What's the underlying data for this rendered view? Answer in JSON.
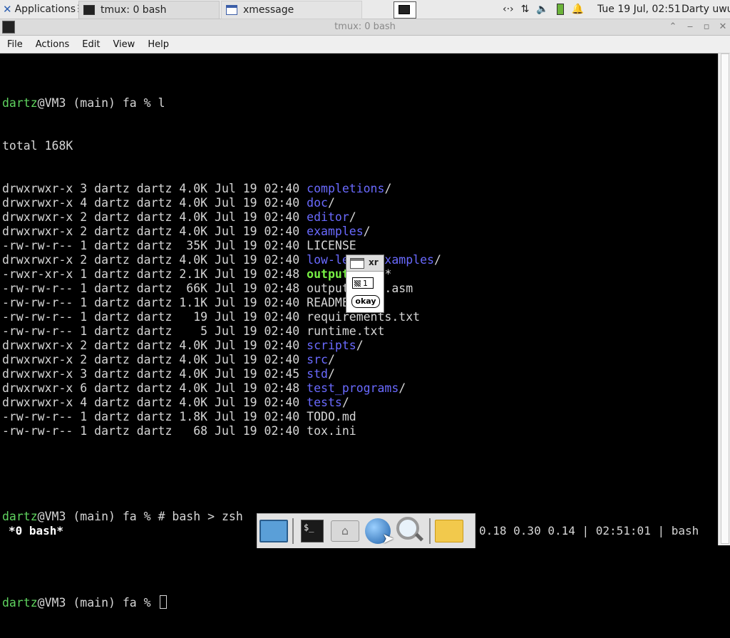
{
  "top_panel": {
    "applications_label": "Applications",
    "tasks": [
      {
        "label": "tmux: 0 bash"
      },
      {
        "label": "xmessage"
      }
    ],
    "clock": "Tue 19 Jul, 02:51",
    "user": "Darty uwu"
  },
  "window": {
    "title": "tmux: 0 bash",
    "menu": [
      "File",
      "Actions",
      "Edit",
      "View",
      "Help"
    ]
  },
  "terminal": {
    "user": "dartz",
    "prompt_rest": "@VM3 (main) fa % ",
    "command1": "l",
    "total": "total 168K",
    "listing": [
      {
        "perm": "drwxrwxr-x 3 dartz dartz 4.0K Jul 19 02:40 ",
        "name": "completions",
        "suffix": "/",
        "kind": "dir"
      },
      {
        "perm": "drwxrwxr-x 4 dartz dartz 4.0K Jul 19 02:40 ",
        "name": "doc",
        "suffix": "/",
        "kind": "dir"
      },
      {
        "perm": "drwxrwxr-x 2 dartz dartz 4.0K Jul 19 02:40 ",
        "name": "editor",
        "suffix": "/",
        "kind": "dir"
      },
      {
        "perm": "drwxrwxr-x 2 dartz dartz 4.0K Jul 19 02:40 ",
        "name": "examples",
        "suffix": "/",
        "kind": "dir"
      },
      {
        "perm": "-rw-rw-r-- 1 dartz dartz  35K Jul 19 02:40 ",
        "name": "LICENSE",
        "suffix": "",
        "kind": "file"
      },
      {
        "perm": "drwxrwxr-x 2 dartz dartz 4.0K Jul 19 02:40 ",
        "name": "low-level-examples",
        "suffix": "/",
        "kind": "dir"
      },
      {
        "perm": "-rwxr-xr-x 1 dartz dartz 2.1K Jul 19 02:48 ",
        "name": "output_file",
        "suffix": "*",
        "kind": "exec"
      },
      {
        "perm": "-rw-rw-r-- 1 dartz dartz  66K Jul 19 02:48 ",
        "name": "output_file.asm",
        "suffix": "",
        "kind": "file"
      },
      {
        "perm": "-rw-rw-r-- 1 dartz dartz 1.1K Jul 19 02:40 ",
        "name": "README.md",
        "suffix": "",
        "kind": "file"
      },
      {
        "perm": "-rw-rw-r-- 1 dartz dartz   19 Jul 19 02:40 ",
        "name": "requirements.txt",
        "suffix": "",
        "kind": "file"
      },
      {
        "perm": "-rw-rw-r-- 1 dartz dartz    5 Jul 19 02:40 ",
        "name": "runtime.txt",
        "suffix": "",
        "kind": "file"
      },
      {
        "perm": "drwxrwxr-x 2 dartz dartz 4.0K Jul 19 02:40 ",
        "name": "scripts",
        "suffix": "/",
        "kind": "dir"
      },
      {
        "perm": "drwxrwxr-x 2 dartz dartz 4.0K Jul 19 02:40 ",
        "name": "src",
        "suffix": "/",
        "kind": "dir"
      },
      {
        "perm": "drwxrwxr-x 3 dartz dartz 4.0K Jul 19 02:45 ",
        "name": "std",
        "suffix": "/",
        "kind": "dir"
      },
      {
        "perm": "drwxrwxr-x 6 dartz dartz 4.0K Jul 19 02:48 ",
        "name": "test_programs",
        "suffix": "/",
        "kind": "dir"
      },
      {
        "perm": "drwxrwxr-x 4 dartz dartz 4.0K Jul 19 02:40 ",
        "name": "tests",
        "suffix": "/",
        "kind": "dir"
      },
      {
        "perm": "-rw-rw-r-- 1 dartz dartz 1.8K Jul 19 02:40 ",
        "name": "TODO.md",
        "suffix": "",
        "kind": "file"
      },
      {
        "perm": "-rw-rw-r-- 1 dartz dartz   68 Jul 19 02:40 ",
        "name": "tox.ini",
        "suffix": "",
        "kind": "file"
      }
    ],
    "command2": "# bash > zsh"
  },
  "tmux": {
    "left": "*0 bash*",
    "right": "0.18 0.30 0.14 | 02:51:01 | bash"
  },
  "xmessage": {
    "title": "xr",
    "message": "1",
    "button": "okay"
  },
  "colors": {
    "prompt_user": "#5fd35f",
    "directory": "#6a6aff",
    "executable": "#77ee44"
  }
}
